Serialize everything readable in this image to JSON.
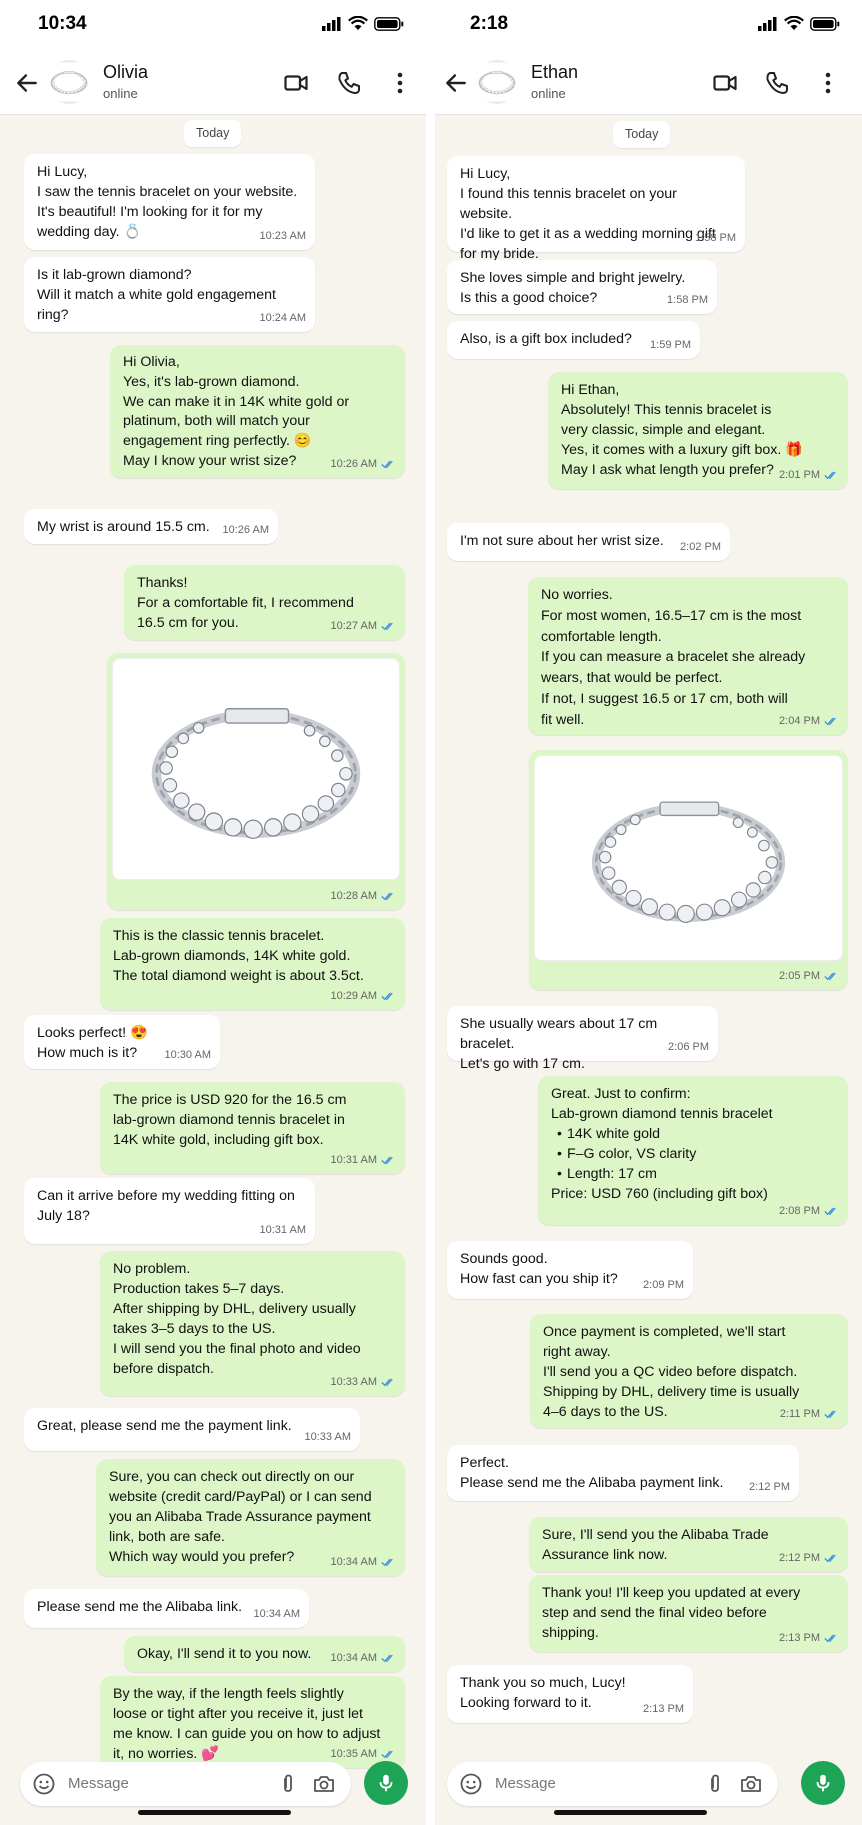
{
  "colors": {
    "incoming": "#ffffff",
    "outgoing": "#dcf6c8",
    "read_ticks": "#3a8ee6",
    "mic_button": "#1ea456",
    "chat_bg": "#f7f4ee"
  },
  "left": {
    "status_time": "10:34",
    "contact": {
      "name": "Olivia",
      "status": "online"
    },
    "day_label": "Today",
    "messages": [
      {
        "dir": "in",
        "text": "Hi Lucy,\nI saw the tennis bracelet on your website.\nIt's beautiful! I'm looking for it for my\nwedding day. 💍",
        "time": "10:23 AM"
      },
      {
        "dir": "in",
        "text": "Is it lab-grown diamond?\nWill it match a white gold engagement\nring?",
        "time": "10:24 AM"
      },
      {
        "dir": "out",
        "text": "Hi Olivia,\nYes, it's lab-grown diamond.\nWe can make it in 14K white gold or\nplatinum, both will match your\nengagement ring perfectly. 😊\nMay I know your wrist size?",
        "time": "10:26 AM"
      },
      {
        "dir": "in",
        "text": "My wrist is around 15.5 cm.",
        "time": "10:26 AM"
      },
      {
        "dir": "out",
        "text": "Thanks!\nFor a comfortable fit, I recommend\n16.5 cm for you.",
        "time": "10:27 AM"
      },
      {
        "dir": "out",
        "image": "tennis-bracelet-photo",
        "time": "10:28 AM"
      },
      {
        "dir": "out",
        "text": "This is the classic tennis bracelet.\nLab-grown diamonds, 14K white gold.\nThe total diamond weight is about 3.5ct.",
        "time": "10:29 AM"
      },
      {
        "dir": "in",
        "text": "Looks perfect! 😍\nHow much is it?",
        "time": "10:30 AM"
      },
      {
        "dir": "out",
        "text": "The price is USD 920 for the 16.5 cm\nlab-grown diamond tennis bracelet in\n14K white gold, including gift box.",
        "time": "10:31 AM"
      },
      {
        "dir": "in",
        "text": "Can it arrive before my wedding fitting on\nJuly 18?",
        "time": "10:31 AM"
      },
      {
        "dir": "out",
        "text": "No problem.\nProduction takes 5–7 days.\nAfter shipping by DHL, delivery usually\ntakes 3–5 days to the US.\nI will send you the final photo and video\nbefore dispatch.",
        "time": "10:33 AM"
      },
      {
        "dir": "in",
        "text": "Great, please send me the payment link.",
        "time": "10:33 AM"
      },
      {
        "dir": "out",
        "text": "Sure, you can check out directly on our\nwebsite (credit card/PayPal) or I can send\nyou an Alibaba Trade Assurance payment\nlink, both are safe.\nWhich way would you prefer?",
        "time": "10:34 AM"
      },
      {
        "dir": "in",
        "text": "Please send me the Alibaba link.",
        "time": "10:34 AM"
      },
      {
        "dir": "out",
        "text": "Okay, I'll send it to you now.",
        "time": "10:34 AM"
      },
      {
        "dir": "out",
        "text": "By the way, if the length feels slightly\nloose or tight after you receive it, just let\nme know. I can guide you on how to adjust\nit, no worries. 💕",
        "time": "10:35 AM"
      }
    ],
    "composer_placeholder": "Message"
  },
  "right": {
    "status_time": "2:18",
    "contact": {
      "name": "Ethan",
      "status": "online"
    },
    "day_label": "Today",
    "messages": [
      {
        "dir": "in",
        "text": "Hi Lucy,\nI found this tennis bracelet on your website.\nI'd like to get it as a wedding morning gift\nfor my bride.",
        "time": "1:58 PM"
      },
      {
        "dir": "in",
        "text": "She loves simple and bright jewelry.\nIs this a good choice?",
        "time": "1:58 PM"
      },
      {
        "dir": "in",
        "text": "Also, is a gift box included?",
        "time": "1:59 PM"
      },
      {
        "dir": "out",
        "text": "Hi Ethan,\nAbsolutely! This tennis bracelet is\nvery classic, simple and elegant.\nYes, it comes with a luxury gift box. 🎁\nMay I ask what length you prefer?",
        "time": "2:01 PM"
      },
      {
        "dir": "in",
        "text": "I'm not sure about her wrist size.",
        "time": "2:02 PM"
      },
      {
        "dir": "out",
        "text": "No worries.\nFor most women, 16.5–17 cm is the most\ncomfortable length.\nIf you can measure a bracelet she already\nwears, that would be perfect.\nIf not, I suggest 16.5 or 17 cm, both will\nfit well.",
        "time": "2:04 PM"
      },
      {
        "dir": "out",
        "image": "tennis-bracelet-photo",
        "time": "2:05 PM"
      },
      {
        "dir": "in",
        "text": "She usually wears about 17 cm bracelet.\nLet's go with 17 cm.",
        "time": "2:06 PM"
      },
      {
        "dir": "out",
        "text_head": "Great. Just to confirm:\nLab-grown diamond tennis bracelet",
        "bullets": [
          "14K white gold",
          "F–G color, VS clarity",
          "Length: 17 cm"
        ],
        "text_tail": "Price: USD 760 (including gift box)",
        "time": "2:08 PM"
      },
      {
        "dir": "in",
        "text": "Sounds good.\nHow fast can you ship it?",
        "time": "2:09 PM"
      },
      {
        "dir": "out",
        "text": "Once payment is completed, we'll start\nright away.\nI'll send you a QC video before dispatch.\nShipping by DHL, delivery time is usually\n4–6 days to the US.",
        "time": "2:11 PM"
      },
      {
        "dir": "in",
        "text": "Perfect.\nPlease send me the Alibaba payment link.",
        "time": "2:12 PM"
      },
      {
        "dir": "out",
        "text": "Sure, I'll send you the Alibaba Trade\nAssurance link now.",
        "time": "2:12 PM"
      },
      {
        "dir": "out",
        "text": "Thank you! I'll keep you updated at every\nstep and send the final video before\nshipping.",
        "time": "2:13 PM"
      },
      {
        "dir": "in",
        "text": "Thank you so much, Lucy!\nLooking forward to it.",
        "time": "2:13 PM"
      }
    ],
    "composer_placeholder": "Message"
  }
}
